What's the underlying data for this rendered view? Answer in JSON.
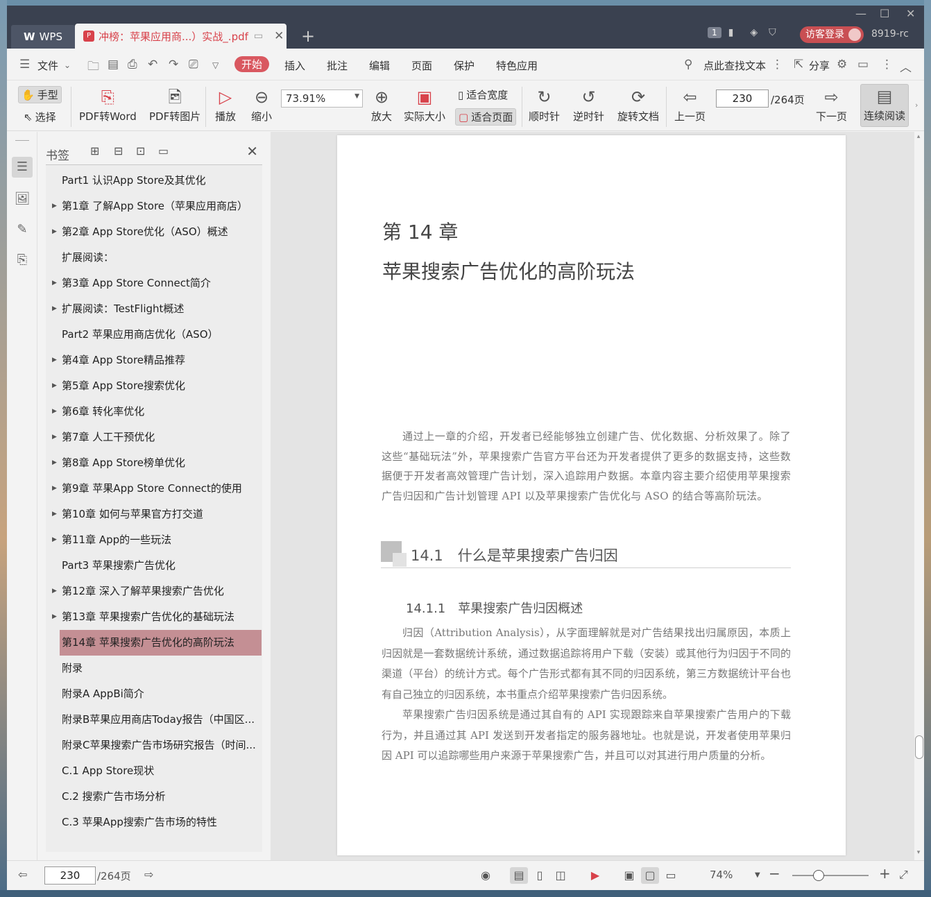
{
  "app": {
    "name": "WPS",
    "doc_tab": "冲榜：苹果应用商...）实战_.pdf",
    "user_id": "8919-rc",
    "login_label": "访客登录",
    "window_count": "1",
    "accent": "#d95860"
  },
  "menu": {
    "file": "文件",
    "items": [
      "开始",
      "插入",
      "批注",
      "编辑",
      "页面",
      "保护",
      "特色应用"
    ],
    "search": "点此查找文本",
    "share": "分享"
  },
  "ribbon": {
    "hand": "手型",
    "select": "选择",
    "pdf_to_word": "PDF转Word",
    "pdf_to_image": "PDF转图片",
    "play": "播放",
    "zoom_out": "缩小",
    "zoom_value": "73.91%",
    "zoom_in": "放大",
    "actual_size": "实际大小",
    "fit_width": "适合宽度",
    "fit_page": "适合页面",
    "rotate_cw": "顺时针",
    "rotate_ccw": "逆时针",
    "rotate_doc": "旋转文档",
    "prev_page": "上一页",
    "page_current": "230",
    "page_total": "/264页",
    "next_page": "下一页",
    "continuous": "连续阅读"
  },
  "bookmarks": {
    "title": "书签",
    "items": [
      {
        "label": "Part1 认识App Store及其优化",
        "arrow": false
      },
      {
        "label": "第1章 了解App Store（苹果应用商店）",
        "arrow": true
      },
      {
        "label": "第2章 App Store优化（ASO）概述",
        "arrow": true
      },
      {
        "label": "扩展阅读：",
        "arrow": false
      },
      {
        "label": "第3章 App Store Connect简介",
        "arrow": true
      },
      {
        "label": "扩展阅读：TestFlight概述",
        "arrow": true
      },
      {
        "label": "Part2 苹果应用商店优化（ASO）",
        "arrow": false
      },
      {
        "label": "第4章 App Store精品推荐",
        "arrow": true
      },
      {
        "label": "第5章 App Store搜索优化",
        "arrow": true
      },
      {
        "label": "第6章 转化率优化",
        "arrow": true
      },
      {
        "label": "第7章 人工干预优化",
        "arrow": true
      },
      {
        "label": "第8章 App Store榜单优化",
        "arrow": true
      },
      {
        "label": "第9章 苹果App Store Connect的使用",
        "arrow": true
      },
      {
        "label": "第10章 如何与苹果官方打交道",
        "arrow": true
      },
      {
        "label": "第11章 App的一些玩法",
        "arrow": true
      },
      {
        "label": "Part3 苹果搜索广告优化",
        "arrow": false
      },
      {
        "label": "第12章 深入了解苹果搜索广告优化",
        "arrow": true
      },
      {
        "label": "第13章 苹果搜索广告优化的基础玩法",
        "arrow": true
      },
      {
        "label": "第14章 苹果搜索广告优化的高阶玩法",
        "arrow": true,
        "selected": true
      },
      {
        "label": "附录",
        "arrow": false
      },
      {
        "label": "附录A AppBi简介",
        "arrow": false
      },
      {
        "label": "附录B苹果应用商店Today报告（中国区...",
        "arrow": false
      },
      {
        "label": "附录C苹果搜索广告市场研究报告（时间...",
        "arrow": false
      },
      {
        "label": "C.1 App Store现状",
        "arrow": false
      },
      {
        "label": "C.2 搜索广告市场分析",
        "arrow": false
      },
      {
        "label": "C.3 苹果App搜索广告市场的特性",
        "arrow": false
      }
    ]
  },
  "page": {
    "chapter_num": "第 14 章",
    "chapter_title": "苹果搜索广告优化的高阶玩法",
    "intro": "通过上一章的介绍，开发者已经能够独立创建广告、优化数据、分析效果了。除了这些“基础玩法”外，苹果搜索广告官方平台还为开发者提供了更多的数据支持，这些数据便于开发者高效管理广告计划，深入追踪用户数据。本章内容主要介绍使用苹果搜索广告归因和广告计划管理 API 以及苹果搜索广告优化与 ASO 的结合等高阶玩法。",
    "section": "14.1　什么是苹果搜索广告归因",
    "subsection": "14.1.1　苹果搜索广告归因概述",
    "para1": "归因（Attribution Analysis），从字面理解就是对广告结果找出归属原因，本质上归因就是一套数据统计系统，通过数据追踪将用户下载（安装）或其他行为归因于不同的渠道（平台）的统计方式。每个广告形式都有其不同的归因系统，第三方数据统计平台也有自己独立的归因系统，本书重点介绍苹果搜索广告归因系统。",
    "para2": "苹果搜索广告归因系统是通过其自有的 API 实现跟踪来自苹果搜索广告用户的下载行为，并且通过其 API 发送到开发者指定的服务器地址。也就是说，开发者使用苹果归因 API 可以追踪哪些用户来源于苹果搜索广告，并且可以对其进行用户质量的分析。"
  },
  "status": {
    "page_current": "230",
    "page_total": "/264页",
    "zoom": "74%"
  }
}
